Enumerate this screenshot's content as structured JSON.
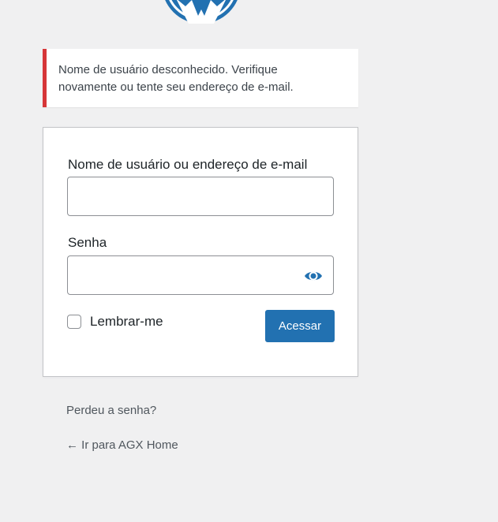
{
  "notice": {
    "line1": "Nome de usuário desconhecido. Verifique",
    "line2": "novamente ou tente seu endereço de e-mail."
  },
  "form": {
    "username_label": "Nome de usuário ou endereço de e-mail",
    "username_value": "",
    "password_label": "Senha",
    "password_value": "",
    "remember_label": "Lembrar-me",
    "remember_checked": false,
    "submit_label": "Acessar"
  },
  "links": {
    "lost_password": "Perdeu a senha?",
    "back_home": "← Ir para AGX Home"
  },
  "icons": {
    "logo": "wordpress-logo-icon",
    "show_password": "eye-icon"
  },
  "colors": {
    "background": "#f0f0f1",
    "accent": "#2271b1",
    "error": "#d63638"
  }
}
